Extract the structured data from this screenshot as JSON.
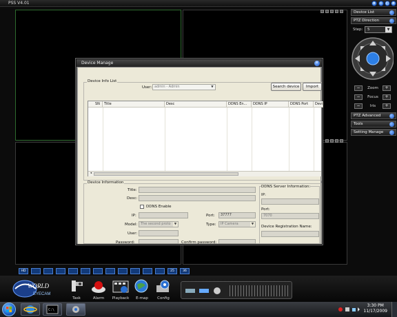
{
  "app": {
    "title": "PSS  V4.01"
  },
  "right_panel": {
    "device_list": "Device List",
    "ptz_direction": "PTZ Direction",
    "step_label": "Step:",
    "step_value": "5",
    "zoom": "Zoom",
    "focus": "Focus",
    "iris": "Iris",
    "ptz_advanced": "PTZ Advanced",
    "tools": "Tools",
    "setting_manage": "Setting Manage",
    "minus": "−",
    "plus": "+"
  },
  "layout_buttons": [
    "HD",
    "",
    "",
    "",
    "",
    "",
    "",
    "",
    "",
    "",
    "",
    "",
    "",
    "",
    "",
    "25",
    "36"
  ],
  "bottom": {
    "logo_top": "WORLD",
    "logo_bottom": "EYECAM",
    "items": [
      "Task",
      "Alarm",
      "Playback",
      "E-map",
      "Config"
    ]
  },
  "dialog": {
    "title": "Device Manage",
    "info_list_title": "Device Info List",
    "user_label": "User:",
    "user_value": "admin - Admin",
    "search_device": "Search device",
    "import": "Import",
    "columns": [
      "SN",
      "Title",
      "Desc",
      "DDNS En...",
      "DDNS IP",
      "DDNS Port",
      "Devic"
    ],
    "info_title": "Device Information",
    "title_label": "Title:",
    "desc_label": "Desc:",
    "ddns_enable": "DDNS Enable",
    "ip_label": "IP:",
    "port_label": "Port:",
    "port_value": "37777",
    "model_label": "Model:",
    "model_value": "The second proto",
    "type_label": "Type:",
    "type_value": "IP Camera",
    "user_field_label": "User:",
    "password_label": "Password:",
    "confirm_password_label": "Confirm password:",
    "ddns_server_info": "DDNS Server Information:",
    "ddns_ip_label": "IP:",
    "ddns_port_label": "Port:",
    "ddns_port_value": "7070",
    "device_reg_name": "Device Registration Name:"
  },
  "taskbar": {
    "time": "3:30 PM",
    "date": "11/17/2009"
  }
}
